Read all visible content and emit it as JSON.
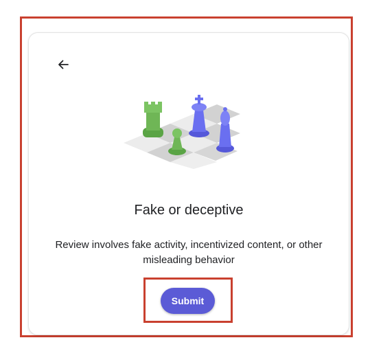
{
  "dialog": {
    "title": "Fake or deceptive",
    "description": "Review involves fake activity, incentivized content, or other misleading behavior",
    "submit_label": "Submit",
    "back_icon": "arrow-left-icon",
    "illustration_icon": "chess-pieces-illustration"
  },
  "colors": {
    "highlight": "#c9402f",
    "button": "#5b5bd6",
    "green_piece": "#6fb656",
    "blue_piece": "#6a6ff0"
  }
}
